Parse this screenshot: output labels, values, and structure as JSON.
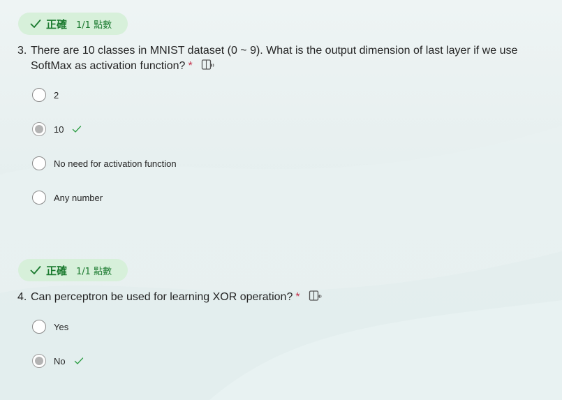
{
  "questions": [
    {
      "badge": {
        "status": "正確",
        "score": "1/1 點數"
      },
      "number": "3.",
      "text": "There are 10 classes in MNIST dataset (0 ~ 9). What is the output dimension of last layer if we use SoftMax as activation function?",
      "required_mark": "*",
      "options": [
        {
          "label": "2",
          "selected": false,
          "correct": false
        },
        {
          "label": "10",
          "selected": true,
          "correct": true
        },
        {
          "label": "No need for activation function",
          "selected": false,
          "correct": false
        },
        {
          "label": "Any number",
          "selected": false,
          "correct": false
        }
      ]
    },
    {
      "badge": {
        "status": "正確",
        "score": "1/1 點數"
      },
      "number": "4.",
      "text": "Can perceptron be used for learning XOR operation?",
      "required_mark": "*",
      "options": [
        {
          "label": "Yes",
          "selected": false,
          "correct": false
        },
        {
          "label": "No",
          "selected": true,
          "correct": true
        }
      ]
    }
  ],
  "icons": {
    "badge_check": "check-icon",
    "reader": "immersive-reader-icon",
    "correct_mark": "checkmark-icon"
  },
  "colors": {
    "badge_bg": "#d7f0da",
    "badge_text": "#1b7a2f",
    "required": "#c4314b",
    "correct_check": "#2e9e45"
  }
}
